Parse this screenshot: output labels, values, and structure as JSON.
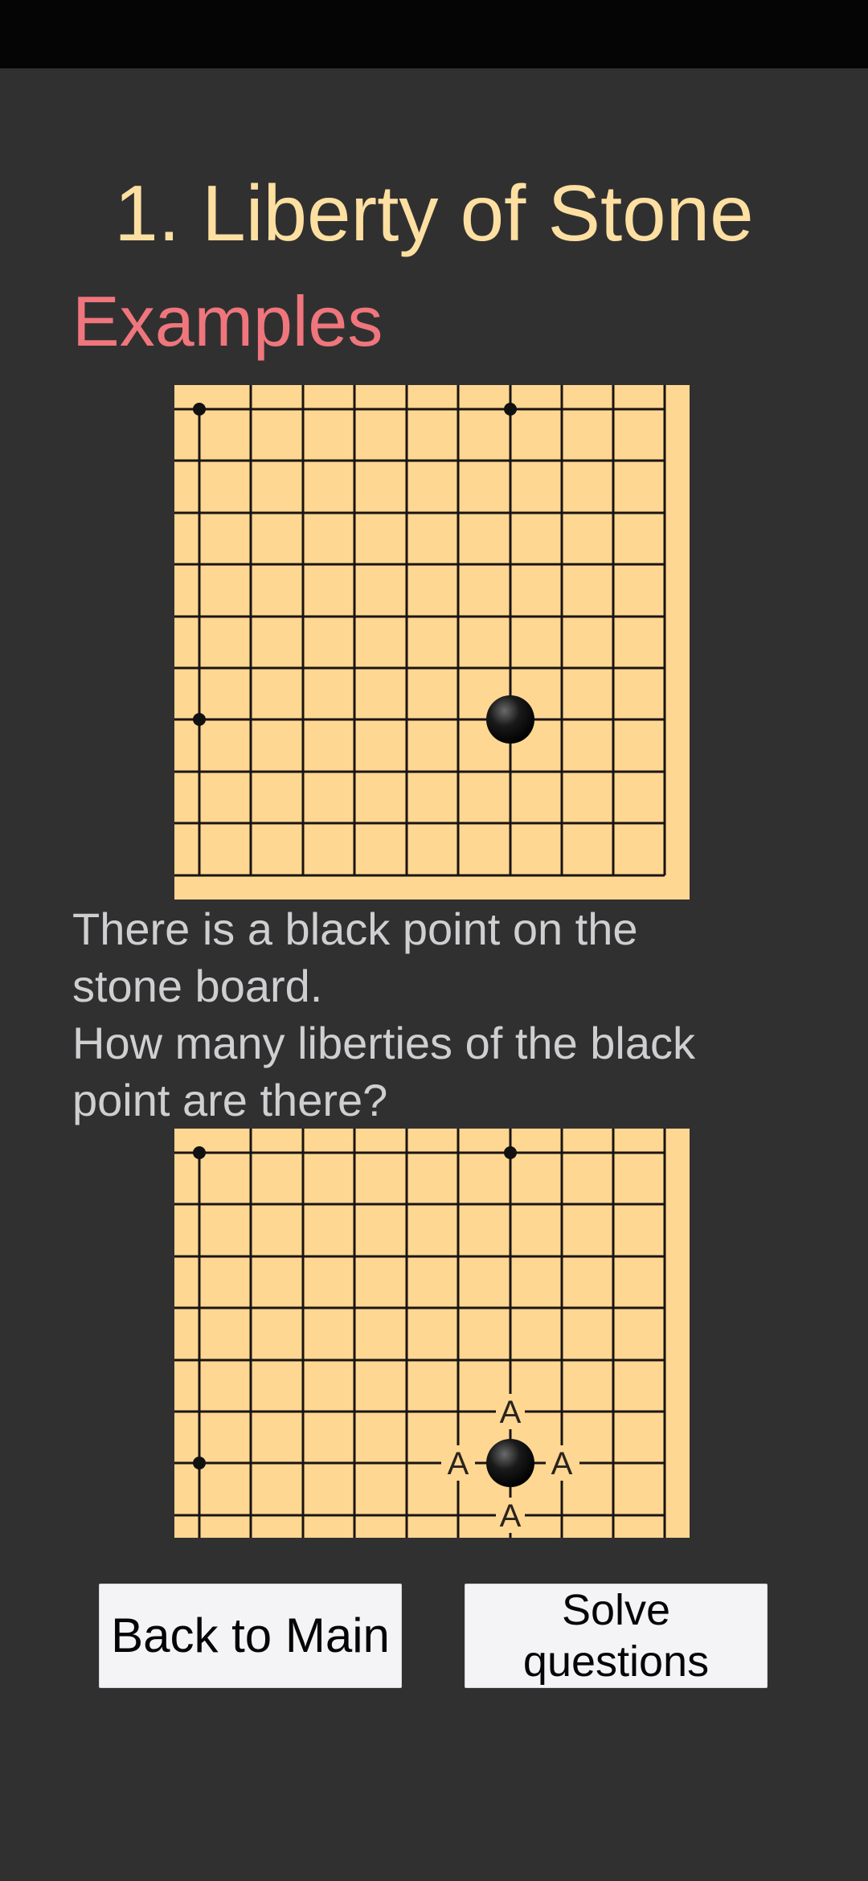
{
  "screen": {
    "title": "1. Liberty of Stone",
    "subtitle": "Examples",
    "description": {
      "line1": "There is a black point on the",
      "line2": "stone board.",
      "line3": "How many liberties of the black",
      "line4": "point are there?"
    }
  },
  "board_example": {
    "stone": "black",
    "liberty_markers": [
      "A",
      "A",
      "A",
      "A"
    ]
  },
  "buttons": {
    "back_label": "Back to Main",
    "solve_label_line1": "Solve",
    "solve_label_line2": "questions"
  },
  "colors": {
    "background": "#313031",
    "title": "#fde0a1",
    "subtitle": "#ef767c",
    "board": "#fed793",
    "text": "#cfcfd1"
  }
}
